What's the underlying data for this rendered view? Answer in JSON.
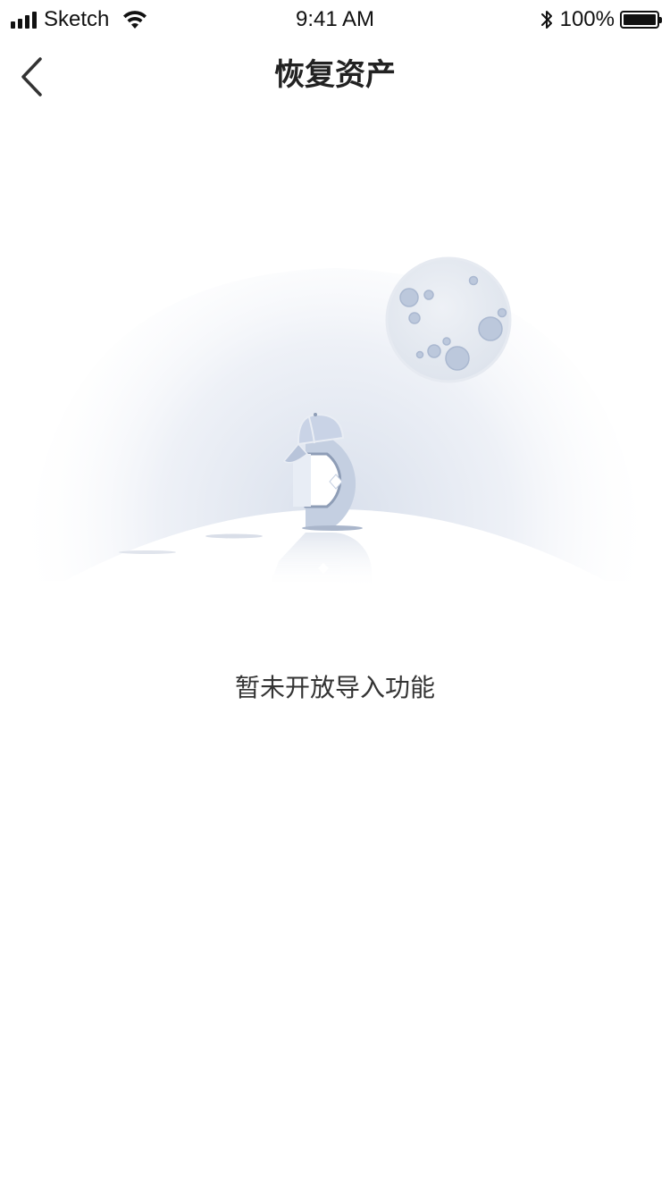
{
  "status_bar": {
    "carrier": "Sketch",
    "time": "9:41 AM",
    "battery_percent": "100%",
    "battery_level": 1.0,
    "icons": [
      "signal-icon",
      "wifi-icon",
      "bluetooth-icon",
      "battery-icon"
    ]
  },
  "nav": {
    "title": "恢复资产",
    "back_icon": "chevron-left-icon"
  },
  "empty_state": {
    "illustration": "moon-and-mascot-illustration",
    "message": "暂未开放导入功能"
  }
}
